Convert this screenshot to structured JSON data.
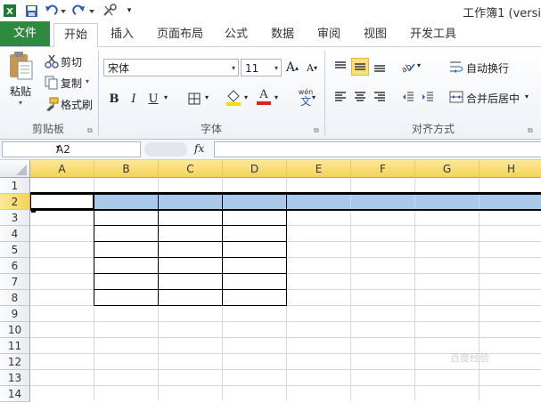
{
  "window": {
    "title": "工作簿1 (versi"
  },
  "quick_access": {
    "icons": [
      "excel-logo-icon",
      "save-icon",
      "undo-icon",
      "redo-icon",
      "tools-icon"
    ]
  },
  "tabs": [
    {
      "label": "文件",
      "active": false
    },
    {
      "label": "开始",
      "active": true
    },
    {
      "label": "插入",
      "active": false
    },
    {
      "label": "页面布局",
      "active": false
    },
    {
      "label": "公式",
      "active": false
    },
    {
      "label": "数据",
      "active": false
    },
    {
      "label": "审阅",
      "active": false
    },
    {
      "label": "视图",
      "active": false
    },
    {
      "label": "开发工具",
      "active": false
    }
  ],
  "ribbon": {
    "clipboard": {
      "label": "剪贴板",
      "paste": "粘贴",
      "cut": "剪切",
      "copy": "复制",
      "format_painter": "格式刷"
    },
    "font": {
      "label": "字体",
      "font_name": "宋体",
      "font_size": "11",
      "bold": "B",
      "italic": "I",
      "underline": "U",
      "font_color_glyph": "A",
      "phonetic_glyph": "wén"
    },
    "alignment": {
      "label": "对齐方式",
      "wrap_text": "自动换行",
      "merge_center": "合并后居中"
    }
  },
  "colors": {
    "file_tab": "#2e8a3e",
    "selected_row": "#a8c9ea",
    "header_highlight": "#f7d25a",
    "fill_yellow": "#ffd800",
    "font_red": "#e02020"
  },
  "formula_bar": {
    "name_box": "A2",
    "fx": "fx",
    "value": ""
  },
  "sheet": {
    "columns": [
      "A",
      "B",
      "C",
      "D",
      "E",
      "F",
      "G",
      "H"
    ],
    "rows": [
      "1",
      "2",
      "3",
      "4",
      "5",
      "6",
      "7",
      "8",
      "9",
      "10",
      "11",
      "12",
      "13",
      "14"
    ],
    "active_cell": "A2",
    "selected_row": "2"
  },
  "watermark": "百度经验"
}
